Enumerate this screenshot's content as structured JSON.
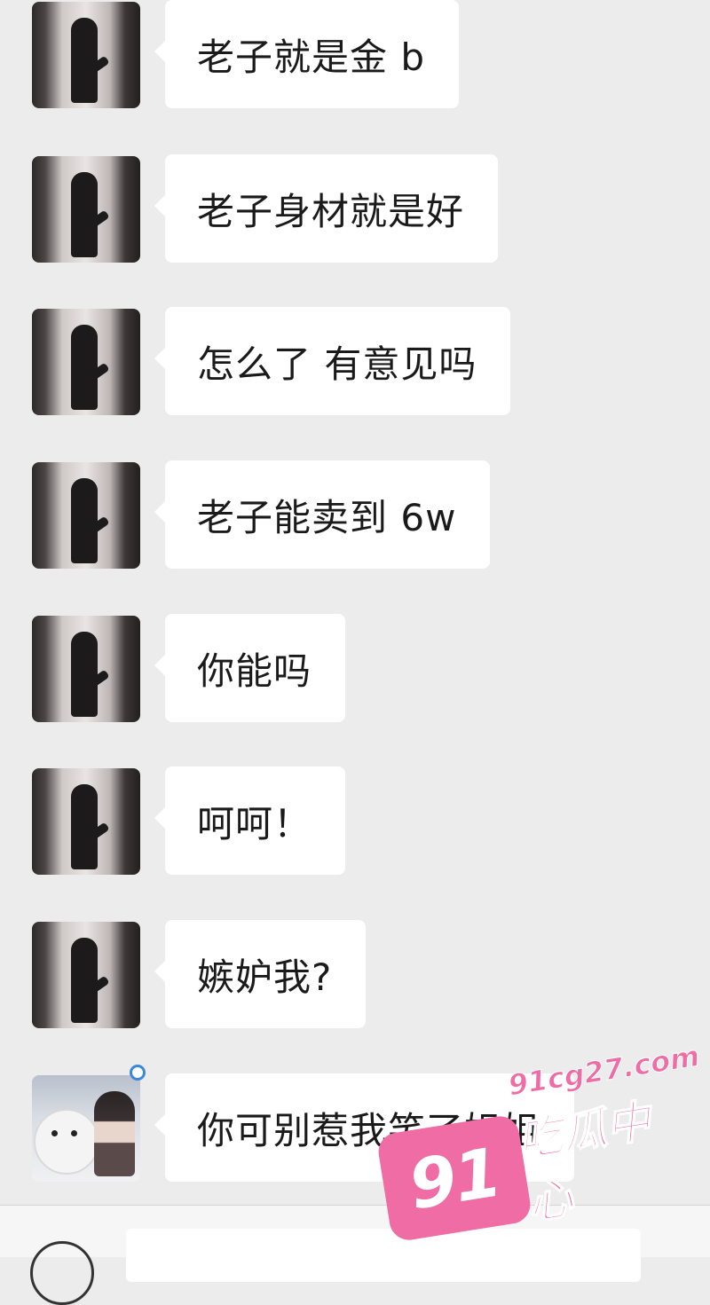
{
  "messages": [
    {
      "text": "老子就是金 b",
      "avatar": "avatar-girl"
    },
    {
      "text": "老子身材就是好",
      "avatar": "avatar-girl"
    },
    {
      "text": "怎么了 有意见吗",
      "avatar": "avatar-girl"
    },
    {
      "text": "老子能卖到 6w",
      "avatar": "avatar-girl"
    },
    {
      "text": "你能吗",
      "avatar": "avatar-girl"
    },
    {
      "text": "呵呵！",
      "avatar": "avatar-girl"
    },
    {
      "text": "嫉妒我?",
      "avatar": "avatar-girl"
    },
    {
      "text": "你可别惹我笑了姐姐",
      "avatar": "avatar-bear"
    }
  ],
  "watermark": {
    "badge": "91",
    "url": "91cg27.com",
    "name": "吃瓜中心"
  },
  "colors": {
    "background": "#ececec",
    "bubble": "#ffffff",
    "watermark": "#f06ca4"
  },
  "icons": {
    "voice": "voice-icon",
    "status": "status-ring-icon"
  }
}
